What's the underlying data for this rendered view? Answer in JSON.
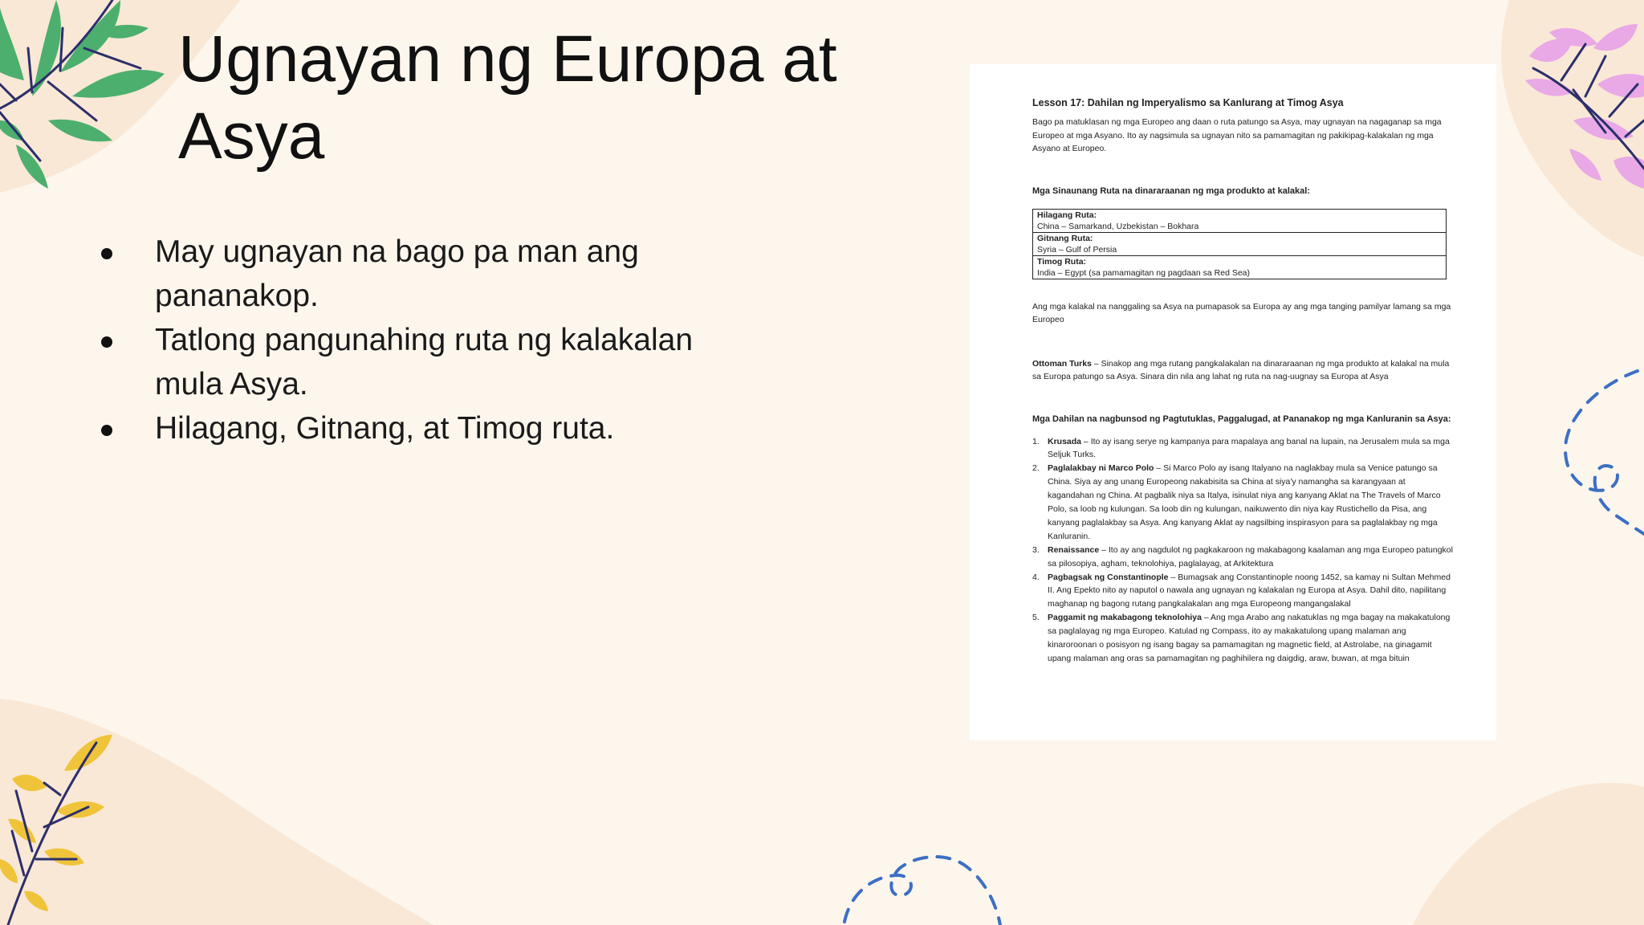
{
  "slide": {
    "title": "Ugnayan ng Europa at Asya",
    "bullets": [
      "May ugnayan na bago pa man ang pananakop.",
      "Tatlong pangunahing ruta ng kalakalan mula Asya.",
      "Hilagang, Gitnang, at Timog ruta."
    ]
  },
  "document": {
    "heading": "Lesson 17: Dahilan ng Imperyalismo sa Kanlurang at Timog Asya",
    "intro": "Bago pa matuklasan ng mga Europeo ang daan o ruta patungo sa Asya, may ugnayan na nagaganap sa mga Europeo at mga Asyano. Ito ay nagsimula sa ugnayan nito sa pamamagitan ng pakikipag-kalakalan ng mga Asyano at Europeo.",
    "routes_heading": "Mga Sinaunang Ruta na dinararaanan ng mga produkto at kalakal:",
    "routes": [
      {
        "name": "Hilagang Ruta:",
        "path": "China – Samarkand, Uzbekistan – Bokhara"
      },
      {
        "name": "Gitnang Ruta:",
        "path": "Syria – Gulf of Persia"
      },
      {
        "name": "Timog Ruta:",
        "path": "India – Egypt (sa pamamagitan ng pagdaan sa Red Sea)"
      }
    ],
    "trade_note": "Ang mga kalakal na nanggaling sa Asya na pumapasok sa Europa ay ang mga tanging pamilyar lamang sa mga Europeo",
    "ottoman_label": "Ottoman Turks",
    "ottoman_text": " – Sinakop ang mga rutang pangkalakalan na dinararaanan ng mga produkto at kalakal na mula sa Europa patungo sa Asya. Sinara din nila ang lahat ng ruta na nag-uugnay sa Europa at Asya",
    "reasons_heading": "Mga Dahilan na nagbunsod ng Pagtutuklas, Paggalugad, at Pananakop ng mga Kanluranin sa Asya:",
    "reasons": [
      {
        "num": "1.",
        "label": "Krusada",
        "text": " – Ito ay isang serye ng kampanya para mapalaya ang banal na lupain, na Jerusalem mula sa mga Seljuk Turks."
      },
      {
        "num": "2.",
        "label": "Paglalakbay ni Marco Polo",
        "text": " – Si Marco Polo ay isang Italyano na naglakbay mula sa Venice patungo sa China. Siya ay ang unang Europeong nakabisita sa China at siya'y namangha sa karangyaan at kagandahan ng China. At pagbalik niya sa Italya, isinulat niya ang kanyang Aklat na The Travels of Marco Polo, sa loob ng kulungan. Sa loob din ng kulungan, naikuwento din niya kay Rustichello da Pisa, ang kanyang paglalakbay sa Asya. Ang kanyang Aklat ay nagsilbing inspirasyon para sa paglalakbay ng mga Kanluranin."
      },
      {
        "num": "3.",
        "label": "Renaissance",
        "text": " – Ito ay ang nagdulot ng pagkakaroon ng makabagong kaalaman ang mga Europeo patungkol sa pilosopiya, agham, teknolohiya, paglalayag, at Arkitektura"
      },
      {
        "num": "4.",
        "label": "Pagbagsak ng Constantinople",
        "text": " – Bumagsak ang Constantinople noong 1452, sa kamay ni Sultan Mehmed II. Ang Epekto nito ay naputol o nawala ang ugnayan ng kalakalan ng Europa at Asya. Dahil dito, napilitang maghanap ng bagong rutang pangkalakalan ang mga Europeong mangangalakal"
      },
      {
        "num": "5.",
        "label": "Paggamit ng makabagong teknolohiya",
        "text": " – Ang mga Arabo ang nakatuklas ng mga bagay na makakatulong sa paglalayag ng mga Europeo. Katulad ng Compass, ito ay makakatulong upang malaman ang kinaroroonan o posisyon ng isang bagay sa pamamagitan ng magnetic field, at Astrolabe, na ginagamit upang malaman ang oras sa pamamagitan ng paghihilera ng daigdig, araw, buwan, at mga bituin"
      }
    ]
  },
  "colors": {
    "background": "#fdf6ec",
    "blob": "#f9e8d6",
    "leaf_green": "#4caf6e",
    "leaf_pink": "#e9a8e6",
    "leaf_yellow": "#f0c43a",
    "stem_navy": "#2c2f6b",
    "dash_blue": "#3c6fc4"
  }
}
